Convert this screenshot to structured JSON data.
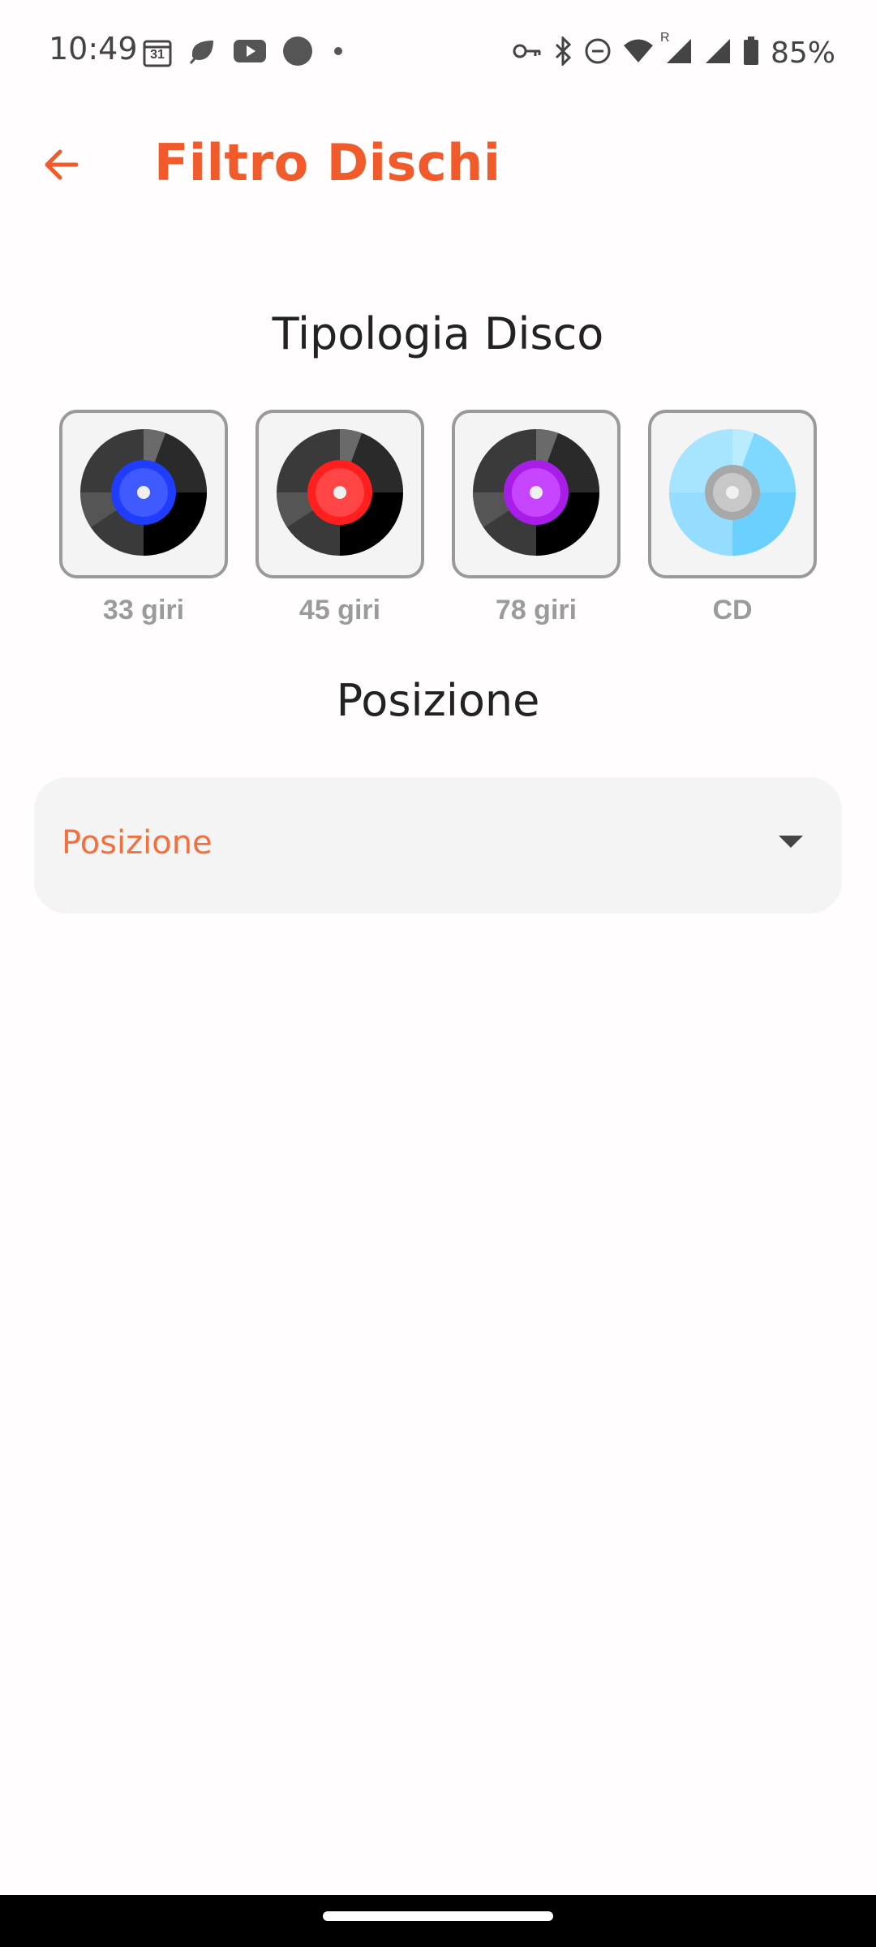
{
  "status_bar": {
    "time": "10:49",
    "calendar_day": "31",
    "battery": "85%",
    "roaming_mark": "R",
    "left_icons": [
      "calendar-icon",
      "leaf-icon",
      "youtube-icon",
      "circle-icon",
      "dot-icon"
    ],
    "right_icons": [
      "key-icon",
      "bluetooth-icon",
      "do-not-disturb-icon",
      "wifi-icon",
      "signal-icon",
      "signal-icon",
      "battery-icon"
    ]
  },
  "app_bar": {
    "title": "Filtro Dischi",
    "back_icon": "arrow-left-icon",
    "accent_color": "#f15a2a"
  },
  "disc_type": {
    "heading": "Tipologia Disco",
    "options": [
      {
        "label": "33 giri",
        "icon": "vinyl-blue-icon",
        "center_color": "#1f3cff"
      },
      {
        "label": "45 giri",
        "icon": "vinyl-red-icon",
        "center_color": "#ff2a2a"
      },
      {
        "label": "78 giri",
        "icon": "vinyl-purple-icon",
        "center_color": "#b02cf0"
      },
      {
        "label": "CD",
        "icon": "cd-icon",
        "center_color": "#c0c0c0"
      }
    ]
  },
  "position": {
    "heading": "Posizione",
    "dropdown_label": "Posizione",
    "dropdown_icon": "dropdown-arrow-icon"
  }
}
